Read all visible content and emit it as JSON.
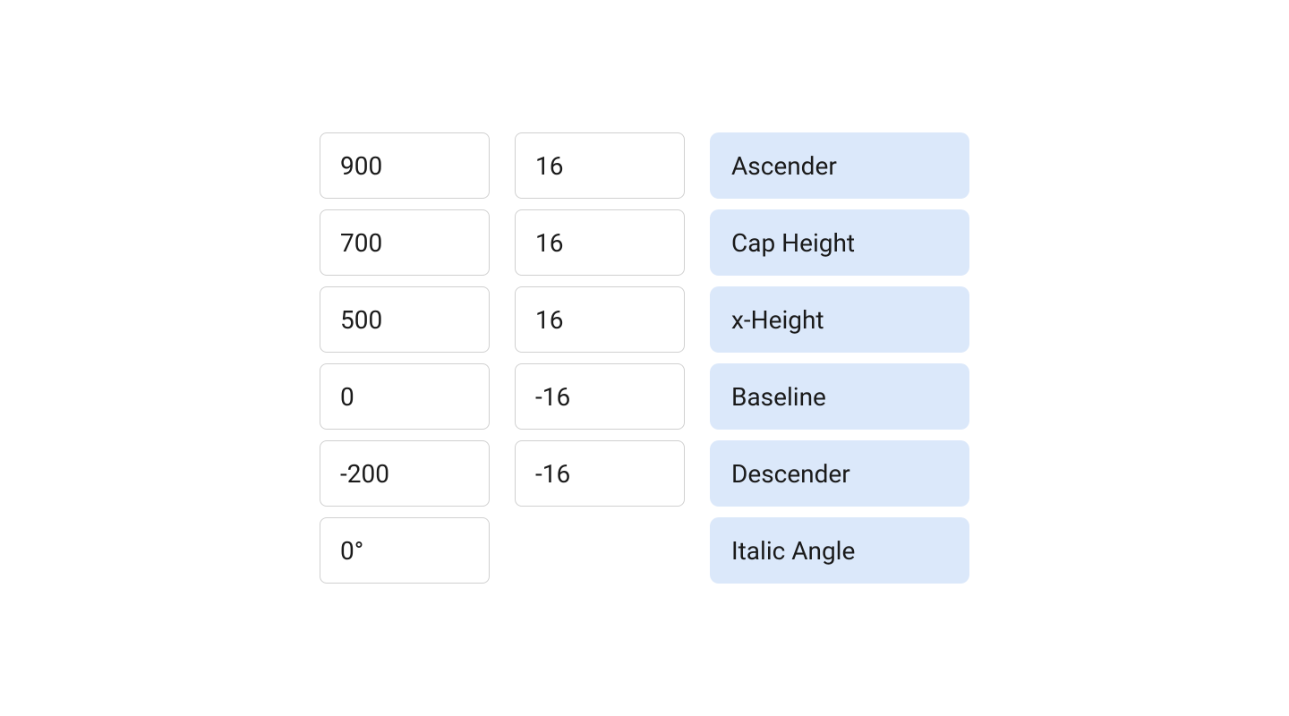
{
  "rows": [
    {
      "col1": "900",
      "col2": "16",
      "col3": "Ascender"
    },
    {
      "col1": "700",
      "col2": "16",
      "col3": "Cap Height"
    },
    {
      "col1": "500",
      "col2": "16",
      "col3": "x-Height"
    },
    {
      "col1": "0",
      "col2": "-16",
      "col3": "Baseline"
    },
    {
      "col1": "-200",
      "col2": "-16",
      "col3": "Descender"
    },
    {
      "col1": "0°",
      "col2": null,
      "col3": "Italic Angle"
    }
  ]
}
